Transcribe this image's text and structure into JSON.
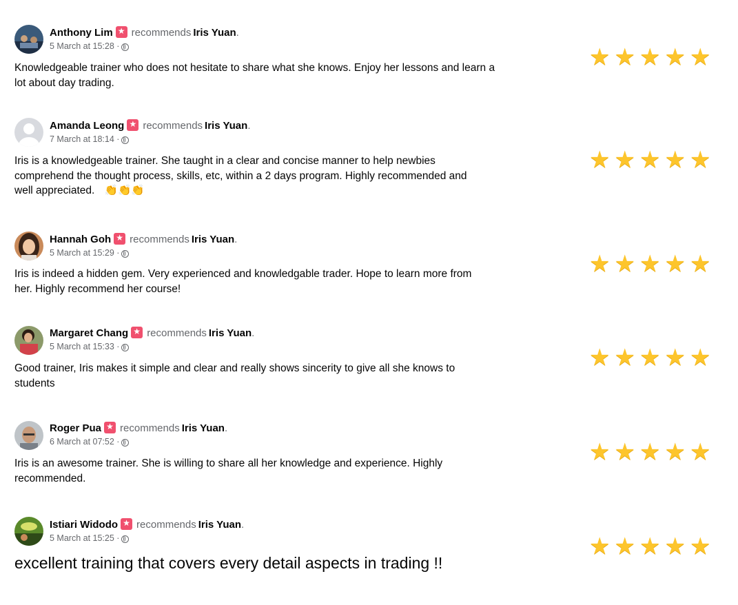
{
  "reviews": [
    {
      "name": "Anthony Lim",
      "recommends": "recommends",
      "target": "Iris Yuan",
      "date": "5 March at 15:28",
      "text": "Knowledgeable trainer who does not hesitate to share what she knows. Enjoy her lessons and learn a lot about day trading.",
      "rating": 5
    },
    {
      "name": "Amanda Leong",
      "recommends": "recommends",
      "target": "Iris Yuan",
      "date": "7 March at 18:14",
      "text": "Iris is a knowledgeable trainer.  She taught in a clear and concise manner to help newbies comprehend the thought process, skills, etc, within a 2 days program.  Highly recommended and well appreciated.",
      "emoji": "👏👏👏",
      "rating": 5
    },
    {
      "name": "Hannah Goh",
      "recommends": "recommends",
      "target": "Iris Yuan",
      "date": "5 March at 15:29",
      "text": "Iris is indeed a hidden gem. Very experienced and knowledgable trader. Hope to learn more from her. Highly recommend her course!",
      "rating": 5
    },
    {
      "name": "Margaret Chang",
      "recommends": "recommends",
      "target": "Iris Yuan",
      "date": "5 March at 15:33",
      "text": "Good trainer, Iris makes it simple and clear and really shows sincerity to give all she knows to students",
      "rating": 5
    },
    {
      "name": "Roger Pua",
      "recommends": "recommends",
      "target": "Iris Yuan",
      "date": "6 March at 07:52",
      "text": "Iris is an awesome trainer. She is willing to share all her knowledge and experience. Highly recommended.",
      "rating": 5
    },
    {
      "name": "Istiari Widodo",
      "recommends": "recommends",
      "target": "Iris Yuan",
      "date": "5 March at 15:25",
      "text": "excellent training that covers every detail aspects in trading !!",
      "rating": 5
    }
  ],
  "separators": {
    "period": ".",
    "dot": "·"
  },
  "icons": {
    "badge": "recommendation-star-badge-icon",
    "globe": "public-globe-icon",
    "star": "rating-star-icon"
  },
  "colors": {
    "star": "#fdc52c",
    "badge": "#f0506e",
    "meta": "#65676b",
    "text": "#050505"
  }
}
